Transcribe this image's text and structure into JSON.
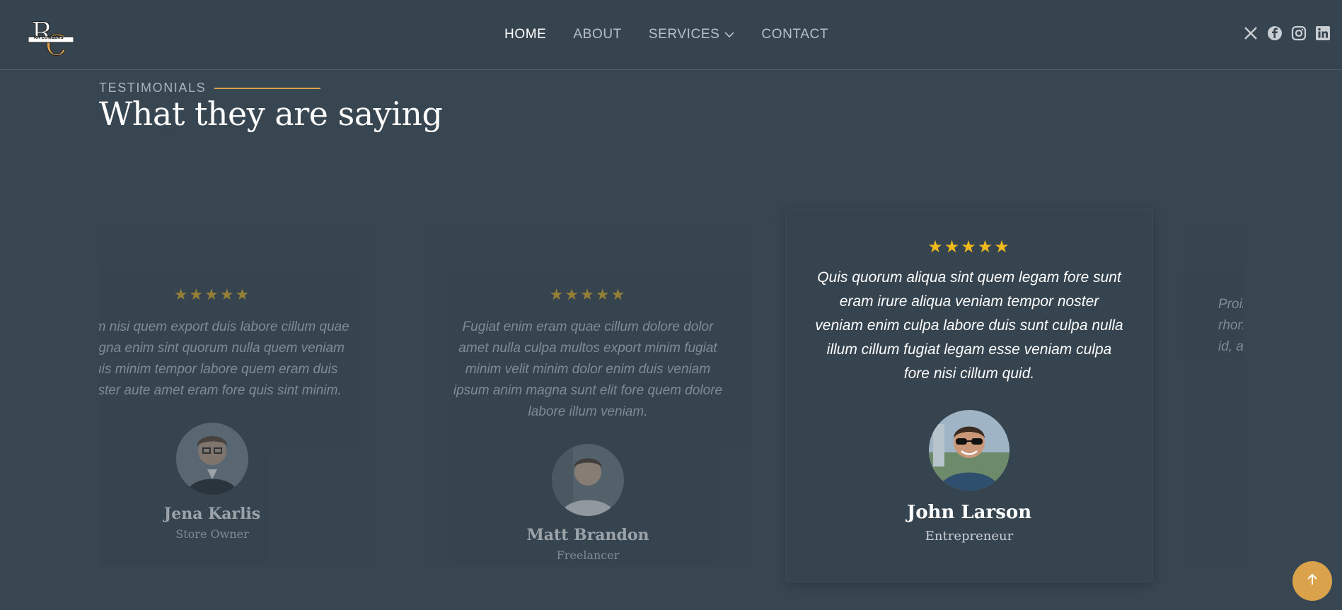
{
  "header": {
    "logo_text": "RR LUMBERS",
    "nav": {
      "home": "HOME",
      "about": "ABOUT",
      "services": "SERVICES",
      "contact": "CONTACT"
    },
    "socials": [
      "x-icon",
      "facebook-icon",
      "instagram-icon",
      "linkedin-icon"
    ]
  },
  "section": {
    "eyebrow": "TESTIMONIALS",
    "title": "What they are saying"
  },
  "stars_glyph": "★★★★★",
  "testimonials": [
    {
      "rating": 5,
      "quote": "Enim nisi quem export duis labore cillum quae magna enim sint quorum nulla quem veniam duis minim tempor labore quem eram duis noster aute amet eram fore quis sint minim.",
      "name": "Jena Karlis",
      "role": "Store Owner"
    },
    {
      "rating": 5,
      "quote": "Fugiat enim eram quae cillum dolore dolor amet nulla culpa multos export minim fugiat minim velit minim dolor enim duis veniam ipsum anim magna sunt elit fore quem dolore labore illum veniam.",
      "name": "Matt Brandon",
      "role": "Freelancer"
    },
    {
      "rating": 5,
      "quote": "Quis quorum aliqua sint quem legam fore sunt eram irure aliqua veniam tempor noster veniam enim culpa labore duis sunt culpa nulla illum cillum fugiat legam esse veniam culpa fore nisi cillum quid.",
      "name": "John Larson",
      "role": "Entrepreneur"
    },
    {
      "rating": 5,
      "quote": "Proin s rhon id, a",
      "name": "",
      "role": ""
    }
  ],
  "colors": {
    "accent": "#d9a24b",
    "background": "#374651",
    "star": "#f0b91c"
  }
}
